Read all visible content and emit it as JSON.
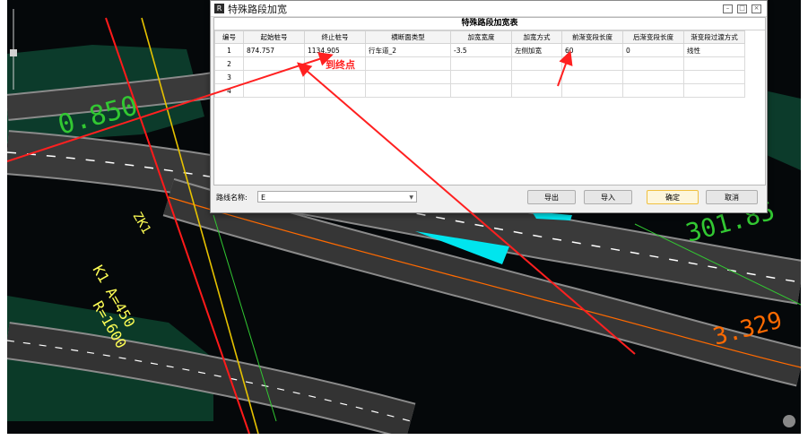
{
  "dialog": {
    "title": "特殊路段加宽",
    "table_title": "特殊路段加宽表",
    "columns": [
      "编号",
      "起始桩号",
      "终止桩号",
      "横断面类型",
      "加宽宽度",
      "加宽方式",
      "前渐变段长度",
      "后渐变段长度",
      "渐变段过渡方式"
    ],
    "rows": [
      [
        "1",
        "874.757",
        "1134.905",
        "行车道_2",
        "-3.5",
        "左侧加宽",
        "60",
        "0",
        "线性"
      ],
      [
        "2",
        "",
        "",
        "",
        "",
        "",
        "",
        "",
        ""
      ],
      [
        "3",
        "",
        "",
        "",
        "",
        "",
        "",
        "",
        ""
      ],
      [
        "4",
        "",
        "",
        "",
        "",
        "",
        "",
        "",
        ""
      ]
    ],
    "route_label": "路线名称:",
    "route_value": "E",
    "buttons": {
      "export": "导出",
      "import": "导入",
      "ok": "确定",
      "cancel": "取消"
    }
  },
  "annotation": {
    "to_end_label": "到终点"
  },
  "cad": {
    "labels": {
      "a1": "K1 A=450",
      "r1": "R=1600",
      "ztext1": "ZK1",
      "stake1": "0.850",
      "stake2": "301.85",
      "stake3": "3.329"
    }
  },
  "colors": {
    "annotation_red": "#ff2020",
    "highlight_cyan": "#00e5ee",
    "cad_green": "#32c832",
    "road_asphalt": "#3a3a3a"
  }
}
